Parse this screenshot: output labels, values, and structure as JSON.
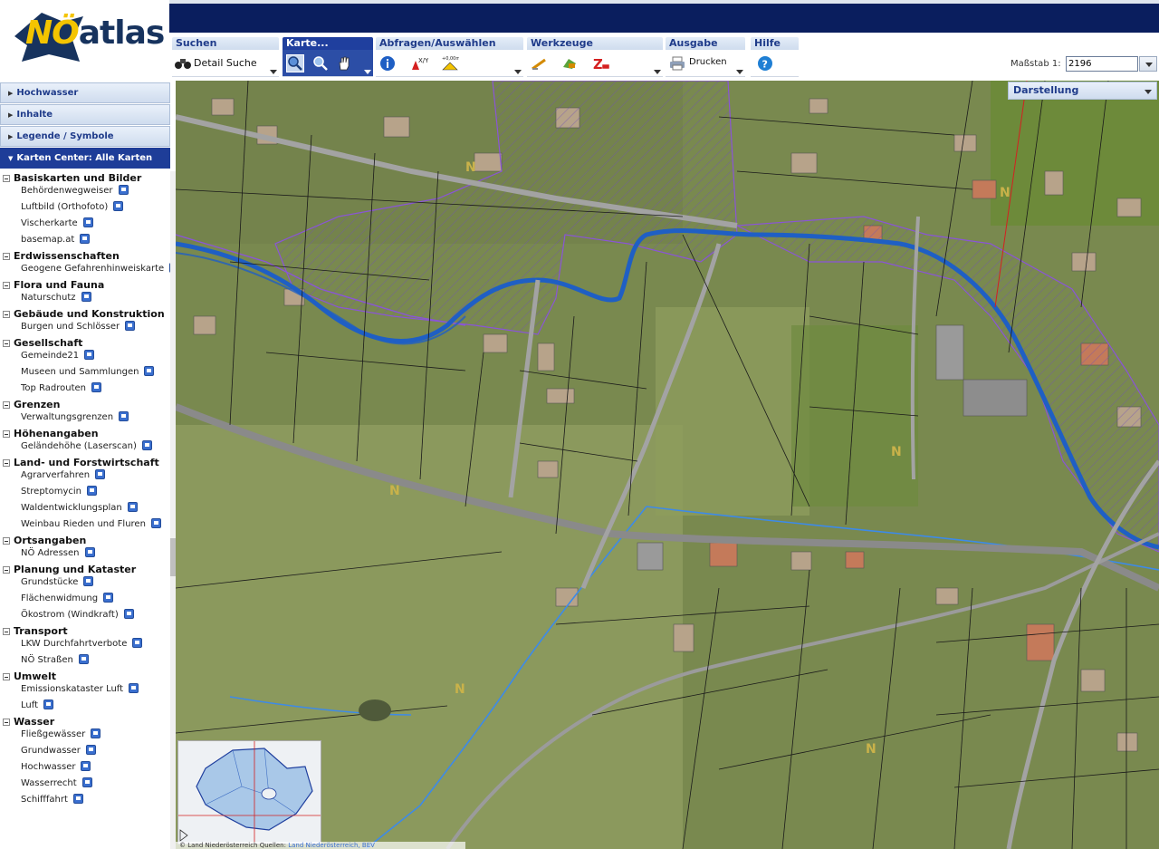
{
  "logo": {
    "prefix": "NÖ",
    "suffix": "atlas"
  },
  "toolbar": {
    "groups": [
      {
        "title": "Suchen",
        "detail_search_label": "Detail Suche"
      },
      {
        "title": "Karte..."
      },
      {
        "title": "Abfragen/Auswählen"
      },
      {
        "title": "Werkzeuge"
      },
      {
        "title": "Ausgabe",
        "print_label": "Drucken"
      },
      {
        "title": "Hilfe"
      }
    ],
    "icons": {
      "binoculars": "binoculars-icon",
      "zoom_in": "zoom-in-icon",
      "zoom_out": "zoom-out-icon",
      "pan": "pan-hand-icon",
      "info": "info-icon",
      "xy": "xy-coordinate-icon",
      "distance": "distance-icon",
      "measure": "measure-icon",
      "area": "area-icon",
      "erase": "erase-icon",
      "print": "printer-icon",
      "help": "help-icon"
    }
  },
  "scale": {
    "label": "Maßstab 1:",
    "value": "2196"
  },
  "sidebar": {
    "panels": [
      {
        "label": "Hochwasser",
        "expanded": false
      },
      {
        "label": "Inhalte",
        "expanded": false
      },
      {
        "label": "Legende / Symbole",
        "expanded": false
      },
      {
        "label": "Karten Center: Alle Karten",
        "expanded": true
      }
    ],
    "categories": [
      {
        "name": "Basiskarten und Bilder",
        "items": [
          "Behördenwegweiser",
          "Luftbild (Orthofoto)",
          "Vischerkarte",
          "basemap.at"
        ]
      },
      {
        "name": "Erdwissenschaften",
        "items": [
          "Geogene Gefahrenhinweiskarte"
        ]
      },
      {
        "name": "Flora und Fauna",
        "items": [
          "Naturschutz"
        ]
      },
      {
        "name": "Gebäude und Konstruktion",
        "items": [
          "Burgen und Schlösser"
        ]
      },
      {
        "name": "Gesellschaft",
        "items": [
          "Gemeinde21",
          "Museen und Sammlungen",
          "Top Radrouten"
        ]
      },
      {
        "name": "Grenzen",
        "items": [
          "Verwaltungsgrenzen"
        ]
      },
      {
        "name": "Höhenangaben",
        "items": [
          "Geländehöhe (Laserscan)"
        ]
      },
      {
        "name": "Land- und Forstwirtschaft",
        "items": [
          "Agrarverfahren",
          "Streptomycin",
          "Waldentwicklungsplan",
          "Weinbau Rieden und Fluren"
        ]
      },
      {
        "name": "Ortsangaben",
        "items": [
          "NÖ Adressen"
        ]
      },
      {
        "name": "Planung und Kataster",
        "items": [
          "Grundstücke",
          "Flächenwidmung",
          "Ökostrom (Windkraft)"
        ]
      },
      {
        "name": "Transport",
        "items": [
          "LKW Durchfahrtverbote",
          "NÖ Straßen"
        ]
      },
      {
        "name": "Umwelt",
        "items": [
          "Emissionskataster Luft",
          "Luft"
        ]
      },
      {
        "name": "Wasser",
        "items": [
          "Fließgewässer",
          "Grundwasser",
          "Hochwasser",
          "Wasserrecht",
          "Schifffahrt"
        ]
      }
    ]
  },
  "map": {
    "darstellung_label": "Darstellung",
    "copyright": "© Land Niederösterreich",
    "source_label": "Quellen:",
    "source_link": "Land Niederösterreich, BEV",
    "colors": {
      "river": "#1f5fc4",
      "flood_zone": "#8a55d6",
      "parcel_lines": "#1a1a1a",
      "road": "#8a8a8a"
    }
  }
}
